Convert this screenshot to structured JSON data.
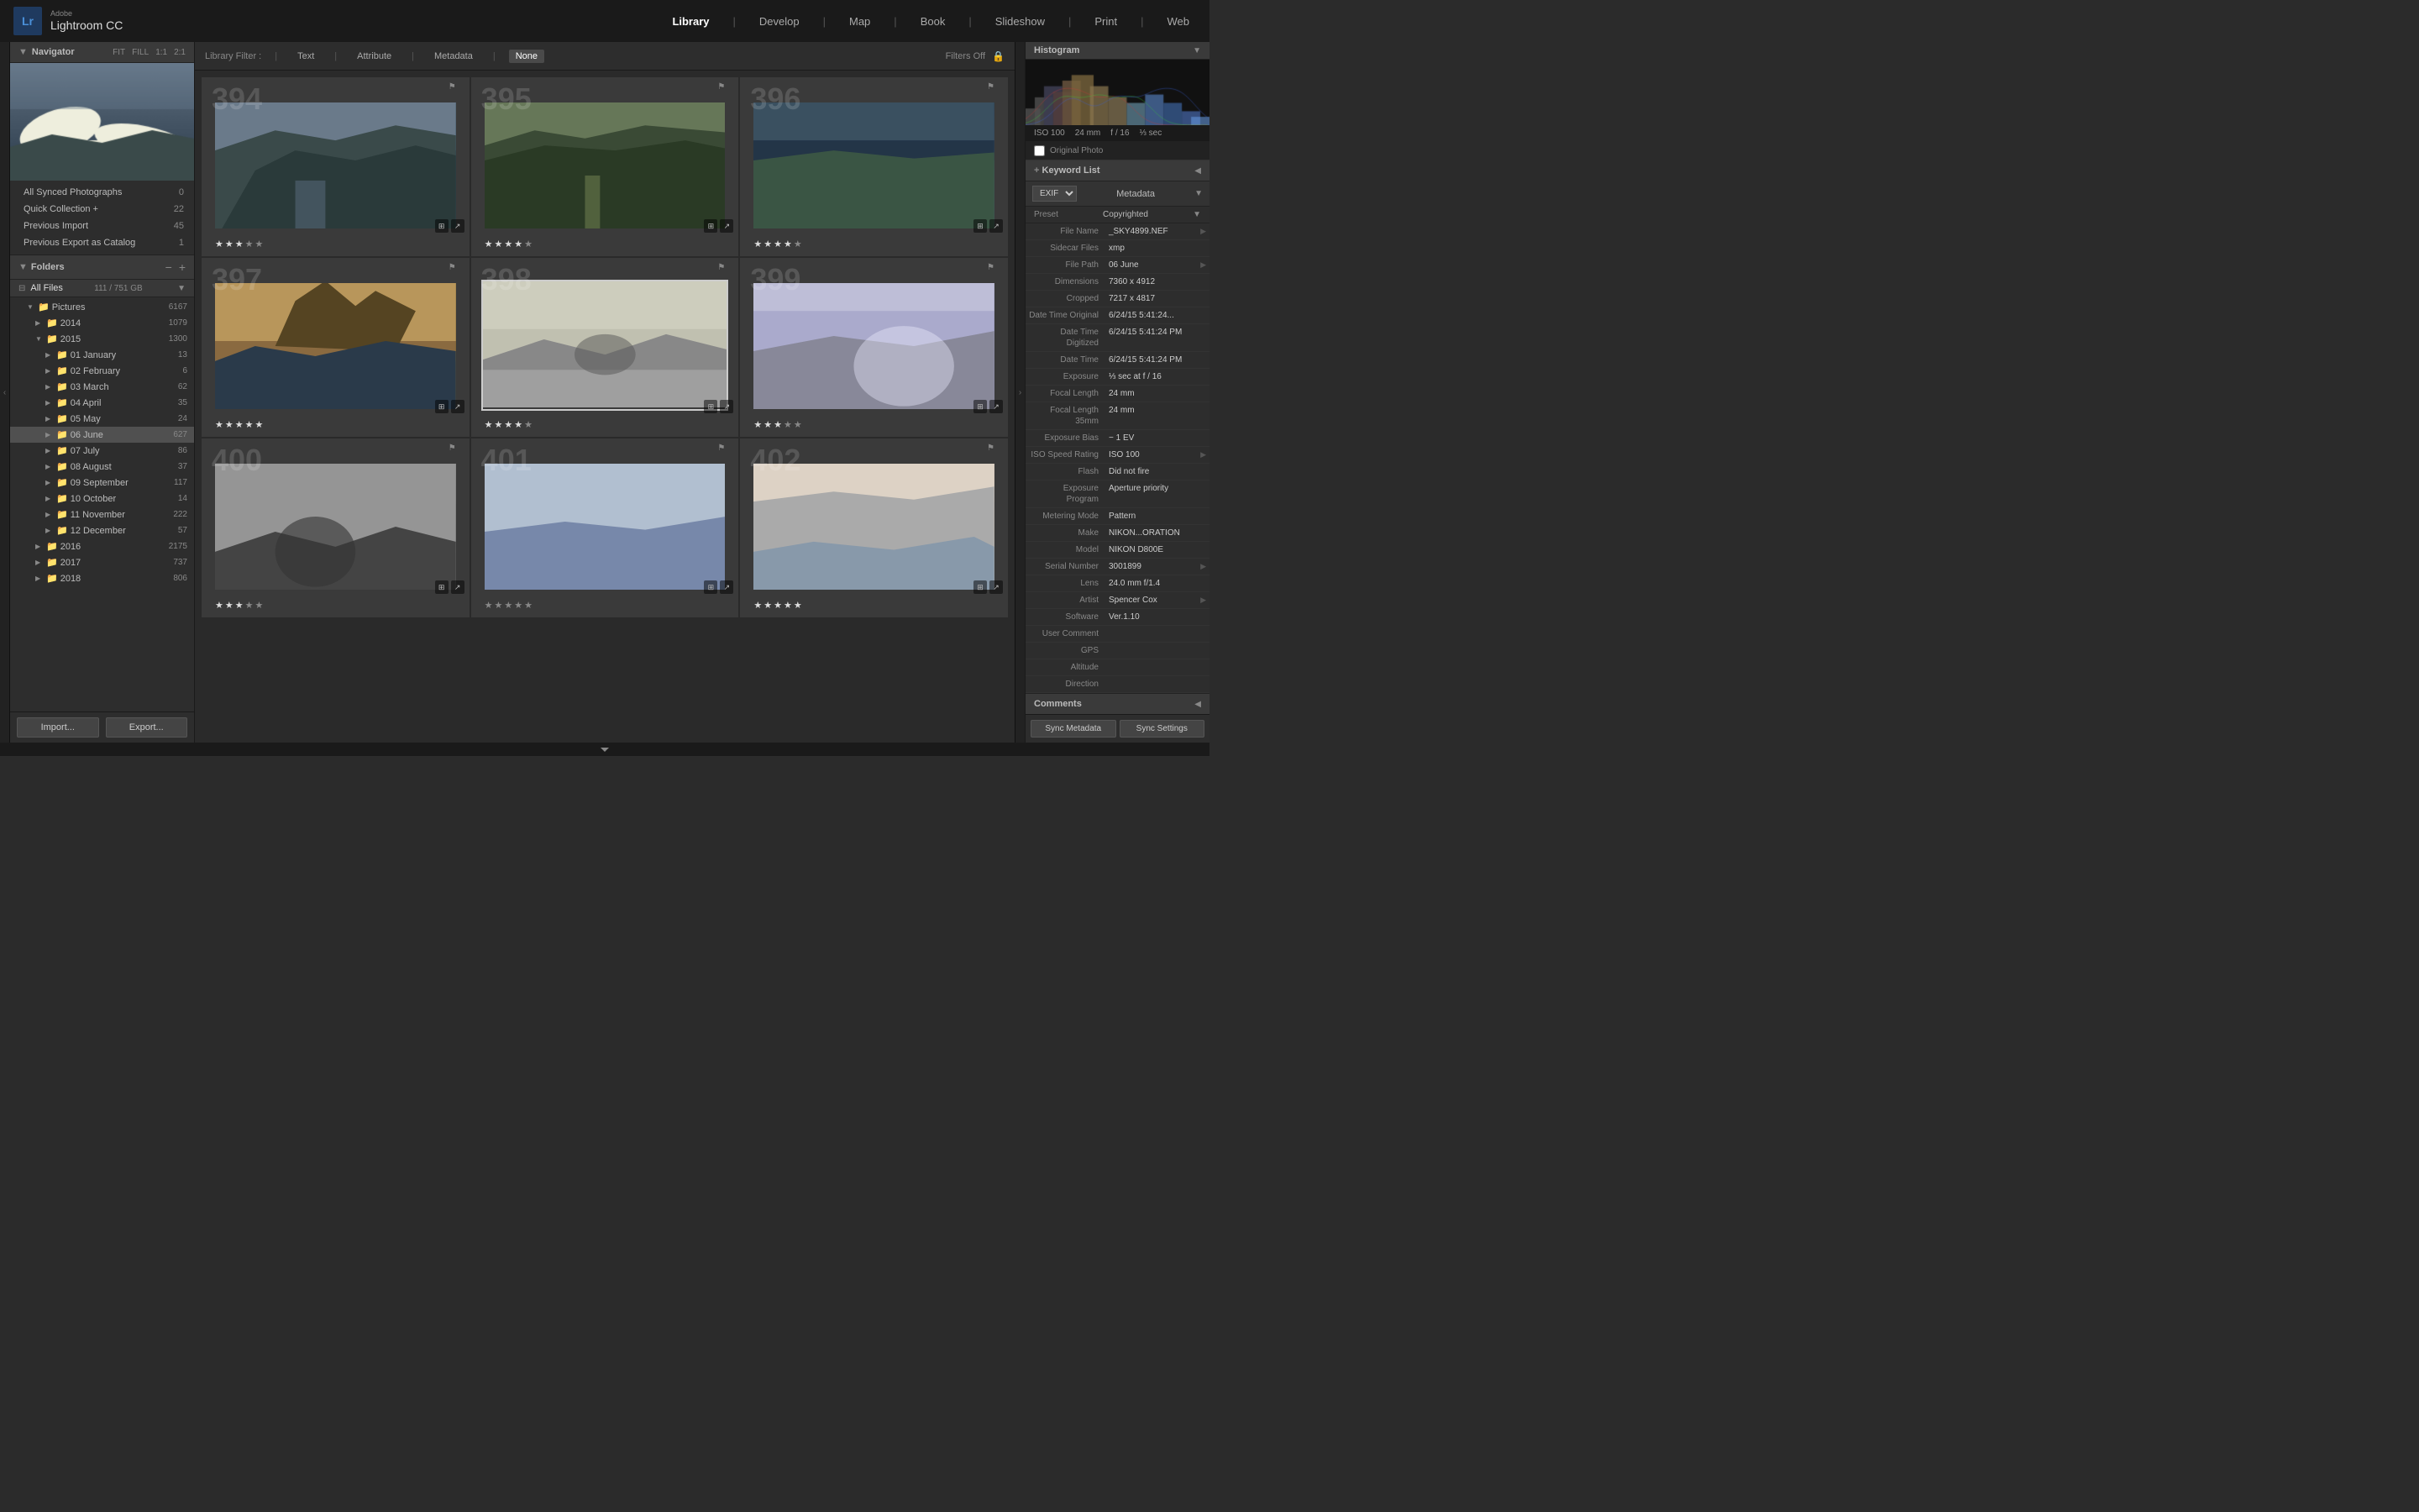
{
  "app": {
    "logo": "Lr",
    "adobe_label": "Adobe",
    "title": "Lightroom CC"
  },
  "top_nav": {
    "items": [
      {
        "label": "Library",
        "active": true
      },
      {
        "label": "Develop",
        "active": false
      },
      {
        "label": "Map",
        "active": false
      },
      {
        "label": "Book",
        "active": false
      },
      {
        "label": "Slideshow",
        "active": false
      },
      {
        "label": "Print",
        "active": false
      },
      {
        "label": "Web",
        "active": false
      }
    ]
  },
  "navigator": {
    "title": "Navigator",
    "zoom_options": [
      "FIT",
      "FILL",
      "1:1",
      "2:1"
    ]
  },
  "catalog": {
    "items": [
      {
        "name": "All Synced Photographs",
        "count": "0"
      },
      {
        "name": "Quick Collection +",
        "count": "22"
      },
      {
        "name": "Previous Import",
        "count": "45"
      },
      {
        "name": "Previous Export as Catalog",
        "count": "1"
      }
    ]
  },
  "folders": {
    "title": "Folders",
    "all_files_label": "All Files",
    "all_files_size": "111 / 751 GB",
    "tree": [
      {
        "name": "Pictures",
        "count": "6167",
        "indent": 1,
        "expanded": true
      },
      {
        "name": "2014",
        "count": "1079",
        "indent": 2,
        "expanded": false
      },
      {
        "name": "2015",
        "count": "1300",
        "indent": 2,
        "expanded": true
      },
      {
        "name": "01 January",
        "count": "13",
        "indent": 3,
        "expanded": false
      },
      {
        "name": "02 February",
        "count": "6",
        "indent": 3,
        "expanded": false
      },
      {
        "name": "03 March",
        "count": "62",
        "indent": 3,
        "expanded": false
      },
      {
        "name": "04 April",
        "count": "35",
        "indent": 3,
        "expanded": false
      },
      {
        "name": "05 May",
        "count": "24",
        "indent": 3,
        "expanded": false
      },
      {
        "name": "06 June",
        "count": "627",
        "indent": 3,
        "expanded": false,
        "active": true
      },
      {
        "name": "07 July",
        "count": "86",
        "indent": 3,
        "expanded": false
      },
      {
        "name": "08 August",
        "count": "37",
        "indent": 3,
        "expanded": false
      },
      {
        "name": "09 September",
        "count": "117",
        "indent": 3,
        "expanded": false
      },
      {
        "name": "10 October",
        "count": "14",
        "indent": 3,
        "expanded": false
      },
      {
        "name": "11 November",
        "count": "222",
        "indent": 3,
        "expanded": false
      },
      {
        "name": "12 December",
        "count": "57",
        "indent": 3,
        "expanded": false
      },
      {
        "name": "2016",
        "count": "2175",
        "indent": 2,
        "expanded": false
      },
      {
        "name": "2017",
        "count": "737",
        "indent": 2,
        "expanded": false
      },
      {
        "name": "2018",
        "count": "806",
        "indent": 2,
        "expanded": false
      }
    ]
  },
  "panel_buttons": {
    "import": "Import...",
    "export": "Export..."
  },
  "filter_bar": {
    "library_filter_label": "Library Filter :",
    "text_label": "Text",
    "attribute_label": "Attribute",
    "metadata_label": "Metadata",
    "none_label": "None",
    "filters_off": "Filters Off"
  },
  "photos": [
    {
      "id": "394",
      "stars": 3,
      "selected": false,
      "class": "photo-1"
    },
    {
      "id": "395",
      "stars": 4,
      "selected": false,
      "class": "photo-2"
    },
    {
      "id": "396",
      "stars": 4,
      "selected": false,
      "class": "photo-3"
    },
    {
      "id": "397",
      "stars": 5,
      "selected": false,
      "class": "photo-4"
    },
    {
      "id": "398",
      "stars": 4,
      "selected": true,
      "class": "photo-5"
    },
    {
      "id": "399",
      "stars": 3,
      "selected": false,
      "class": "photo-6"
    },
    {
      "id": "400",
      "stars": 3,
      "selected": false,
      "class": "photo-7"
    },
    {
      "id": "401",
      "stars": 0,
      "selected": false,
      "class": "photo-8"
    },
    {
      "id": "402",
      "stars": 5,
      "selected": false,
      "class": "photo-9"
    }
  ],
  "histogram": {
    "title": "Histogram",
    "iso": "ISO 100",
    "focal": "24 mm",
    "aperture": "f / 16",
    "shutter": "⅓ sec",
    "original_photo_label": "Original Photo"
  },
  "keyword_list": {
    "title": "Keyword List"
  },
  "metadata": {
    "title": "Metadata",
    "exif_label": "EXIF",
    "preset_label": "Preset",
    "preset_value": "Copyrighted",
    "fields": [
      {
        "label": "File Name",
        "value": "_SKY4899.NEF"
      },
      {
        "label": "Sidecar Files",
        "value": "xmp"
      },
      {
        "label": "File Path",
        "value": "06 June"
      },
      {
        "label": "Dimensions",
        "value": "7360 x 4912"
      },
      {
        "label": "Cropped",
        "value": "7217 x 4817"
      },
      {
        "label": "Date Time Original",
        "value": "6/24/15 5:41:24..."
      },
      {
        "label": "Date Time Digitized",
        "value": "6/24/15 5:41:24 PM"
      },
      {
        "label": "Date Time",
        "value": "6/24/15 5:41:24 PM"
      },
      {
        "label": "Exposure",
        "value": "⅓ sec at f / 16"
      },
      {
        "label": "Focal Length",
        "value": "24 mm"
      },
      {
        "label": "Focal Length 35mm",
        "value": "24 mm"
      },
      {
        "label": "Exposure Bias",
        "value": "− 1 EV"
      },
      {
        "label": "ISO Speed Rating",
        "value": "ISO 100"
      },
      {
        "label": "Flash",
        "value": "Did not fire"
      },
      {
        "label": "Exposure Program",
        "value": "Aperture priority"
      },
      {
        "label": "Metering Mode",
        "value": "Pattern"
      },
      {
        "label": "Make",
        "value": "NIKON...ORATION"
      },
      {
        "label": "Model",
        "value": "NIKON D800E"
      },
      {
        "label": "Serial Number",
        "value": "3001899"
      },
      {
        "label": "Lens",
        "value": "24.0 mm f/1.4"
      },
      {
        "label": "Artist",
        "value": "Spencer Cox"
      },
      {
        "label": "Software",
        "value": "Ver.1.10"
      },
      {
        "label": "User Comment",
        "value": ""
      },
      {
        "label": "GPS",
        "value": ""
      },
      {
        "label": "Altitude",
        "value": ""
      },
      {
        "label": "Direction",
        "value": ""
      }
    ]
  },
  "bottom_right": {
    "sync_metadata": "Sync Metadata",
    "sync_settings": "Sync Settings"
  },
  "comments": {
    "title": "Comments"
  }
}
